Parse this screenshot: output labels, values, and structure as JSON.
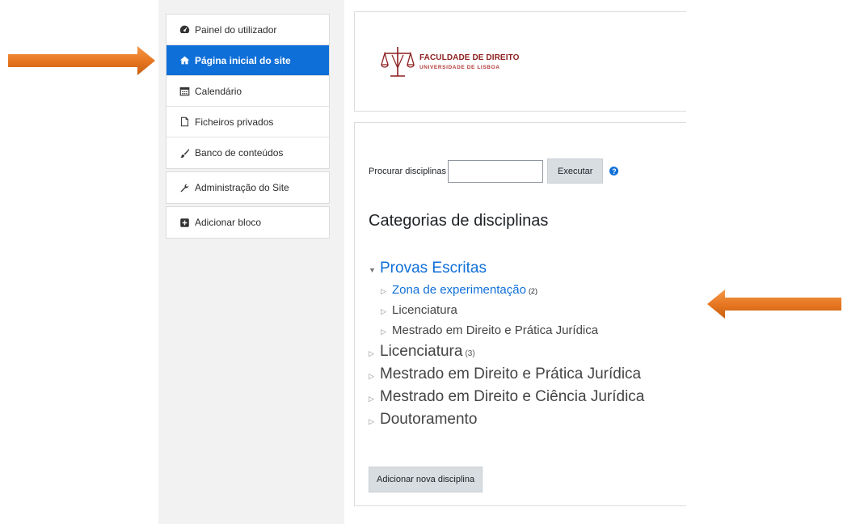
{
  "nav": {
    "group1": [
      {
        "label": "Painel do utilizador",
        "icon": "dashboard-icon",
        "active": false
      },
      {
        "label": "Página inicial do site",
        "icon": "home-icon",
        "active": true
      },
      {
        "label": "Calendário",
        "icon": "calendar-icon",
        "active": false
      },
      {
        "label": "Ficheiros privados",
        "icon": "file-icon",
        "active": false
      },
      {
        "label": "Banco de conteúdos",
        "icon": "brush-icon",
        "active": false
      }
    ],
    "group2": [
      {
        "label": "Administração do Site",
        "icon": "wrench-icon"
      }
    ],
    "group3": [
      {
        "label": "Adicionar bloco",
        "icon": "plus-square-icon"
      }
    ]
  },
  "logo": {
    "line1": "FACULDADE DE DIREITO",
    "line2": "UNIVERSIDADE DE LISBOA"
  },
  "search": {
    "label": "Procurar disciplinas",
    "value": "",
    "button": "Executar",
    "help_icon": "question-circle-icon"
  },
  "categories": {
    "heading": "Categorias de disciplinas",
    "tree": [
      {
        "label": "Provas Escritas",
        "level": 0,
        "expanded": true,
        "link": true,
        "count": ""
      },
      {
        "label": "Zona de experimentação",
        "level": 1,
        "expanded": false,
        "link": true,
        "count": "(2)"
      },
      {
        "label": "Licenciatura",
        "level": 1,
        "expanded": false,
        "link": false,
        "count": ""
      },
      {
        "label": "Mestrado em Direito e Prática Jurídica",
        "level": 1,
        "expanded": false,
        "link": false,
        "count": ""
      },
      {
        "label": "Licenciatura",
        "level": 0,
        "expanded": false,
        "link": false,
        "count": "(3)"
      },
      {
        "label": "Mestrado em Direito e Prática Jurídica",
        "level": 0,
        "expanded": false,
        "link": false,
        "count": ""
      },
      {
        "label": "Mestrado em Direito e Ciência Jurídica",
        "level": 0,
        "expanded": false,
        "link": false,
        "count": ""
      },
      {
        "label": "Doutoramento",
        "level": 0,
        "expanded": false,
        "link": false,
        "count": ""
      }
    ],
    "add_button": "Adicionar nova disciplina"
  },
  "colors": {
    "accent": "#0f6fd8",
    "arrow": "#e87722",
    "logo": "#8e1f1f"
  }
}
